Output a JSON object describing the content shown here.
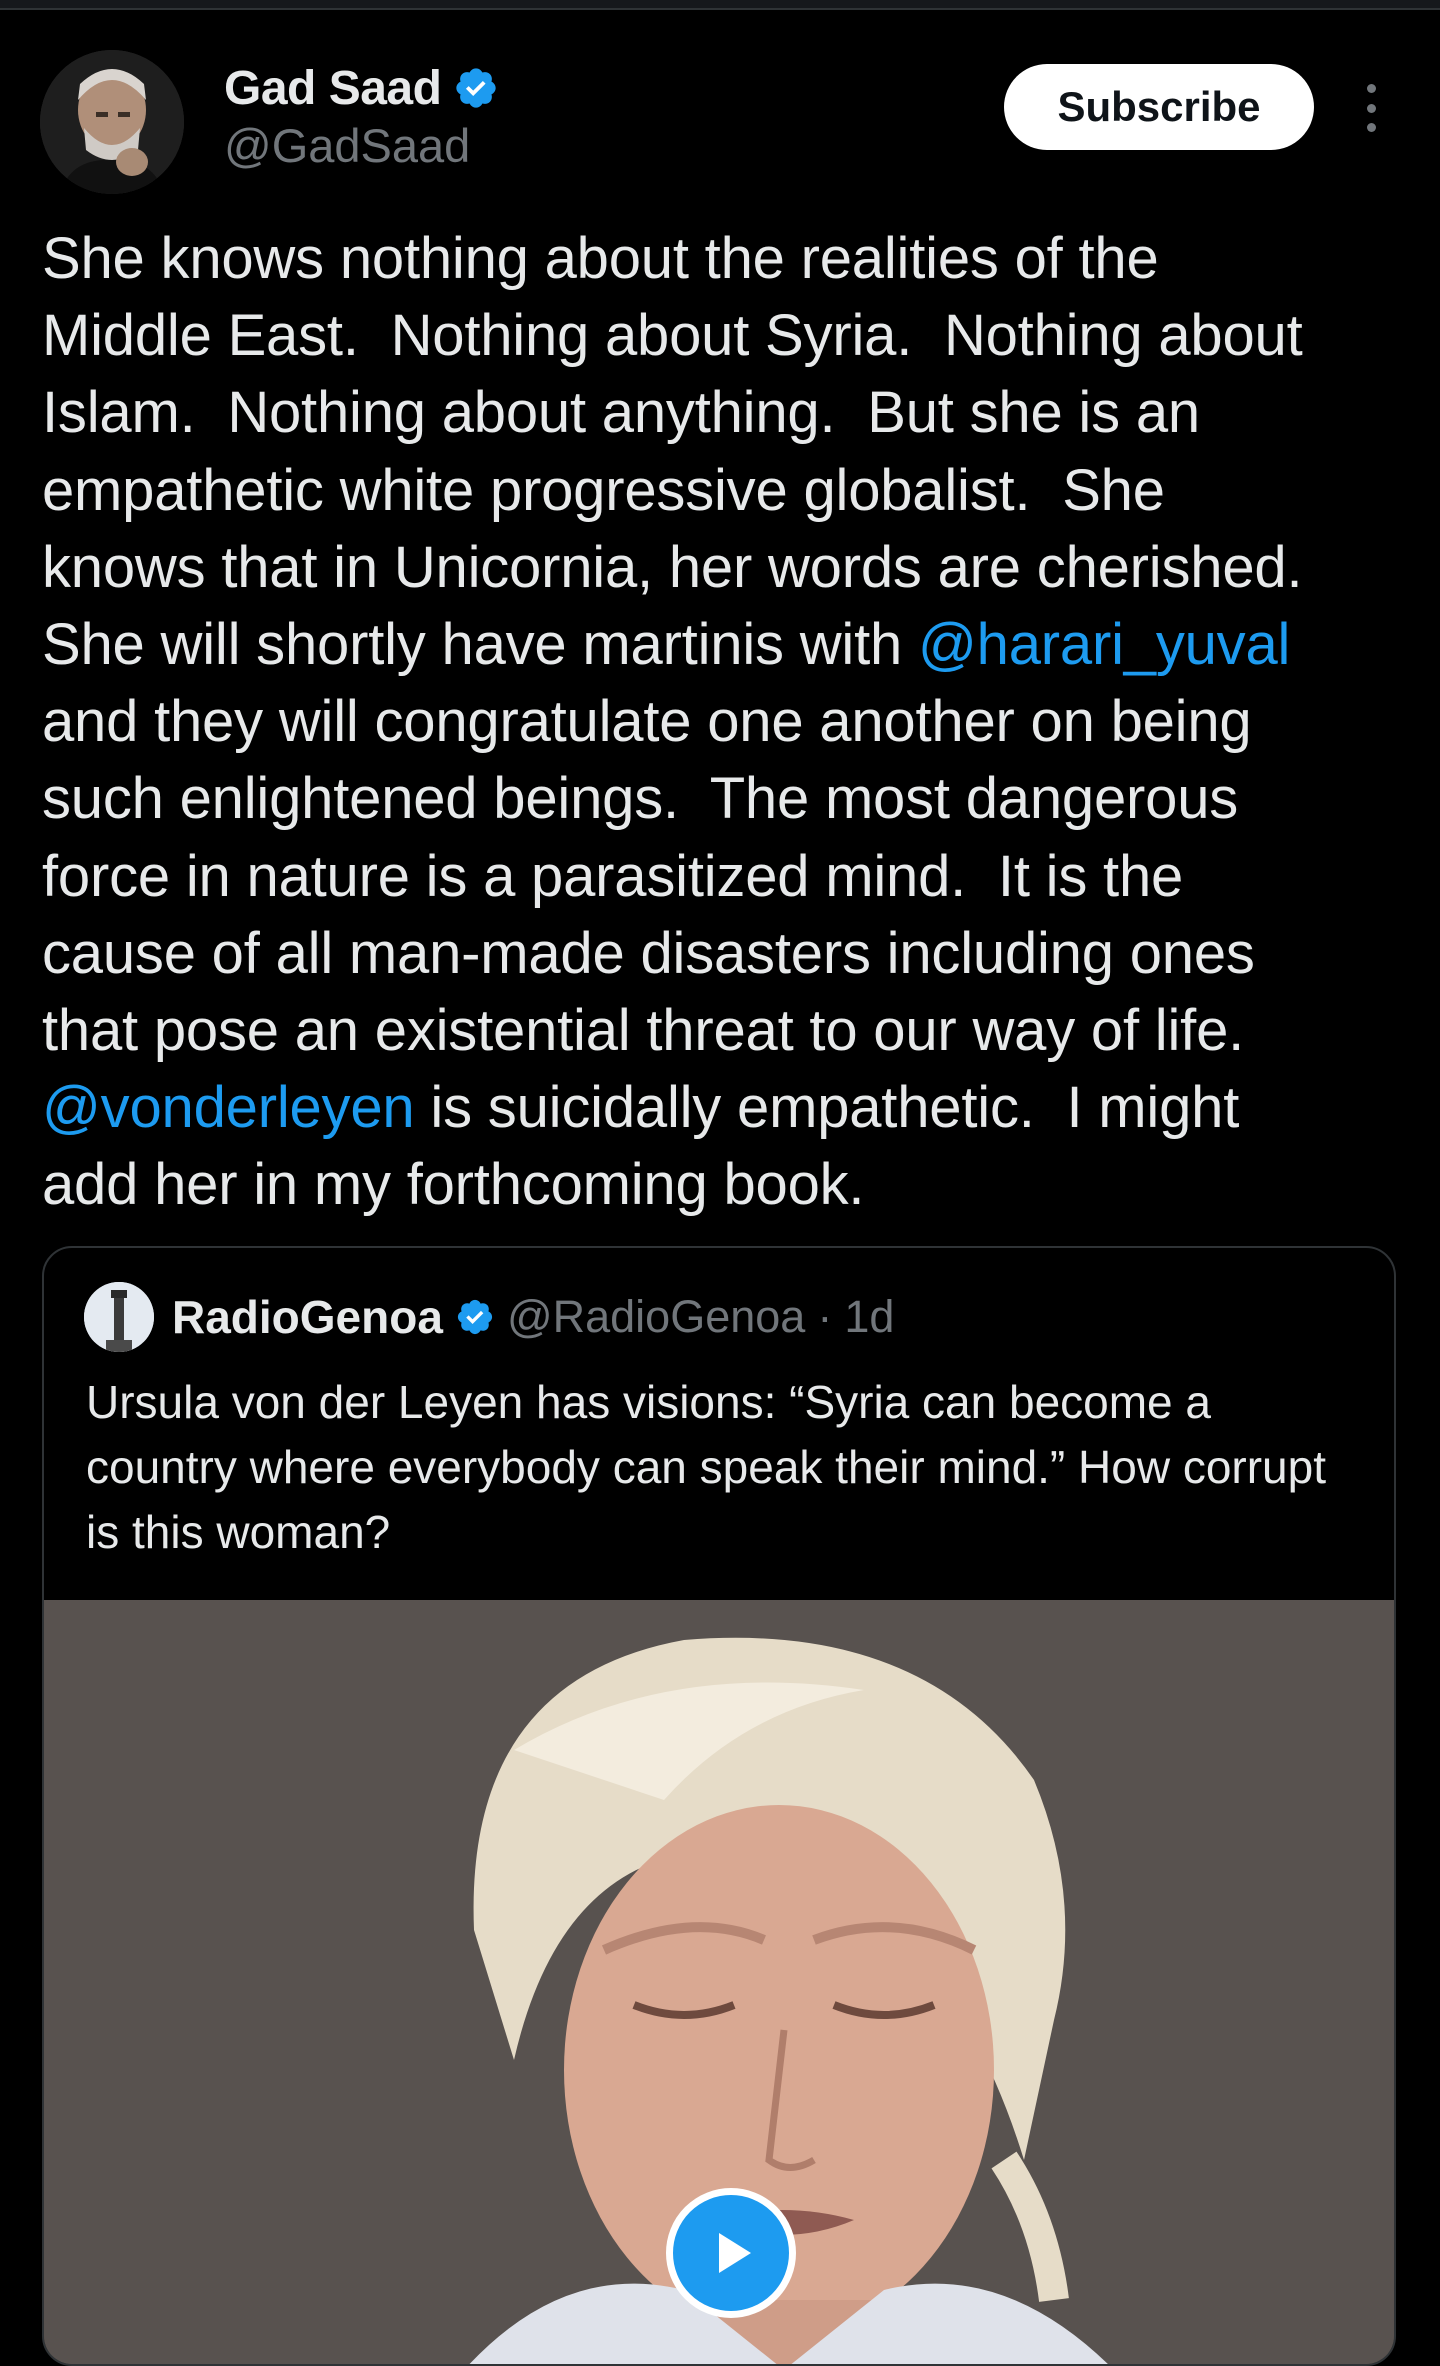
{
  "author": {
    "name": "Gad Saad",
    "handle": "@GadSaad",
    "avatar_icon": "person-avatar-icon",
    "verified": true
  },
  "subscribe": {
    "label": "Subscribe"
  },
  "more": {
    "icon": "more-vertical-icon"
  },
  "tweet": {
    "text_1": "She knows nothing about the realities of the\nMiddle East.  Nothing about Syria.  Nothing about\nIslam.  Nothing about anything.  But she is an\nempathetic white progressive globalist.  She\nknows that in Unicornia, her words are cherished.\nShe will shortly have martinis with ",
    "mention_1": "@harari_yuval",
    "text_2": "\nand they will congratulate one another on being\nsuch enlightened beings.  The most dangerous\nforce in nature is a parasitized mind.  It is the\ncause of all man-made disasters including ones\nthat pose an existential threat to our way of life.\n",
    "mention_2": "@vonderleyen",
    "text_3": " is suicidally empathetic.  I might\nadd her in my forthcoming book."
  },
  "quote": {
    "name": "RadioGenoa",
    "handle": "@RadioGenoa",
    "separator": "·",
    "time": "1d",
    "verified": true,
    "text": "Ursula von der Leyen has visions: “Syria can become a country where everybody can speak their mind.” How corrupt is this woman?",
    "media_icon": "video-thumbnail",
    "play_icon": "play-icon"
  },
  "colors": {
    "background": "#000000",
    "text": "#e7e9ea",
    "secondary": "#71767b",
    "accent": "#1d9bf0",
    "border": "#2f3336"
  }
}
